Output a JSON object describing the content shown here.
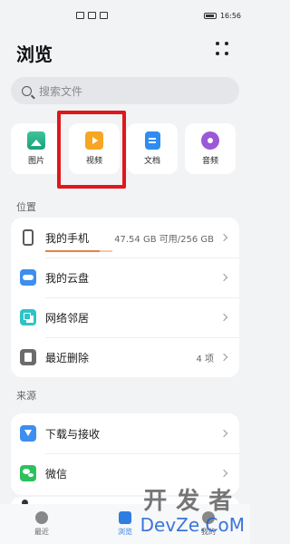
{
  "status_bar": {
    "time": "16:56"
  },
  "header": {
    "title": "浏览"
  },
  "search": {
    "placeholder": "搜索文件"
  },
  "categories": [
    {
      "label": "图片",
      "icon": "image-icon"
    },
    {
      "label": "视频",
      "icon": "video-icon"
    },
    {
      "label": "文档",
      "icon": "document-icon"
    },
    {
      "label": "音频",
      "icon": "audio-icon"
    }
  ],
  "sections": {
    "location_label": "位置",
    "source_label": "来源"
  },
  "location_items": [
    {
      "label": "我的手机",
      "meta": "47.54 GB 可用/256 GB",
      "icon": "phone-icon",
      "used_fraction": 0.81
    },
    {
      "label": "我的云盘",
      "meta": "",
      "icon": "cloud-icon"
    },
    {
      "label": "网络邻居",
      "meta": "",
      "icon": "network-icon"
    },
    {
      "label": "最近删除",
      "meta": "4 项",
      "icon": "trash-icon"
    }
  ],
  "source_items": [
    {
      "label": "下载与接收",
      "icon": "download-icon"
    },
    {
      "label": "微信",
      "icon": "wechat-icon"
    }
  ],
  "bottom_nav": [
    {
      "label": "最近",
      "active": false
    },
    {
      "label": "浏览",
      "active": true
    },
    {
      "label": "我的",
      "active": false
    }
  ],
  "watermark": {
    "top": "开发者",
    "bottom": "DevZe.CoM"
  },
  "colors": {
    "highlight": "#e0171b",
    "accent": "#2f7de1"
  }
}
